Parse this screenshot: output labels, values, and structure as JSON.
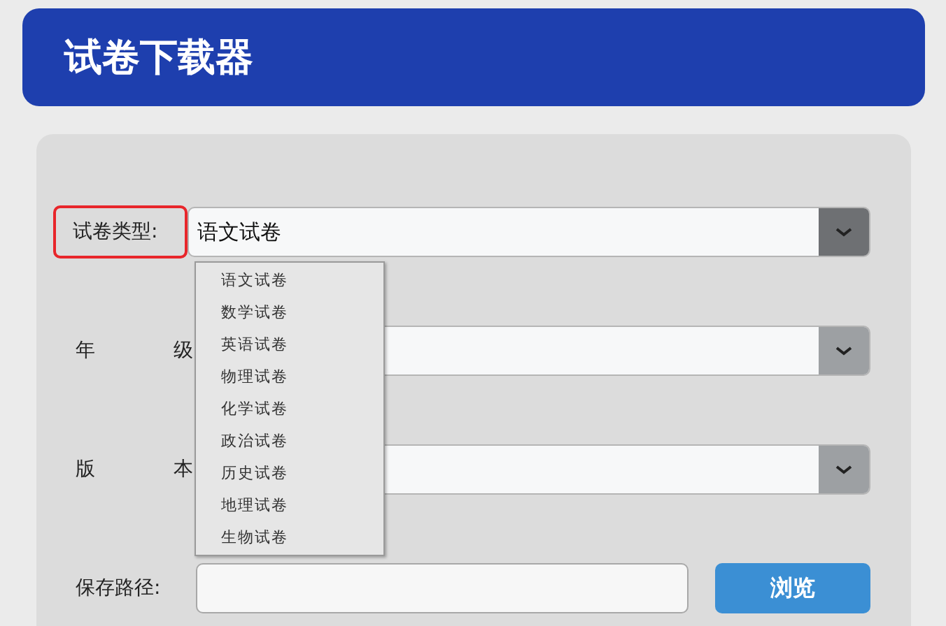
{
  "header": {
    "title": "试卷下载器"
  },
  "fields": [
    {
      "kind": "select",
      "label": "试卷类型:",
      "highlighted": true,
      "value": "语文试卷",
      "expanded": true,
      "options": [
        "语文试卷",
        "数学试卷",
        "英语试卷",
        "物理试卷",
        "化学试卷",
        "政治试卷",
        "历史试卷",
        "地理试卷",
        "生物试卷"
      ]
    },
    {
      "kind": "select",
      "label": "年级",
      "highlighted": false,
      "expanded": false
    },
    {
      "kind": "select",
      "label": "版本",
      "highlighted": false,
      "expanded": false
    },
    {
      "kind": "path",
      "label": "保存路径:",
      "highlighted": false,
      "button": "浏览"
    }
  ]
}
